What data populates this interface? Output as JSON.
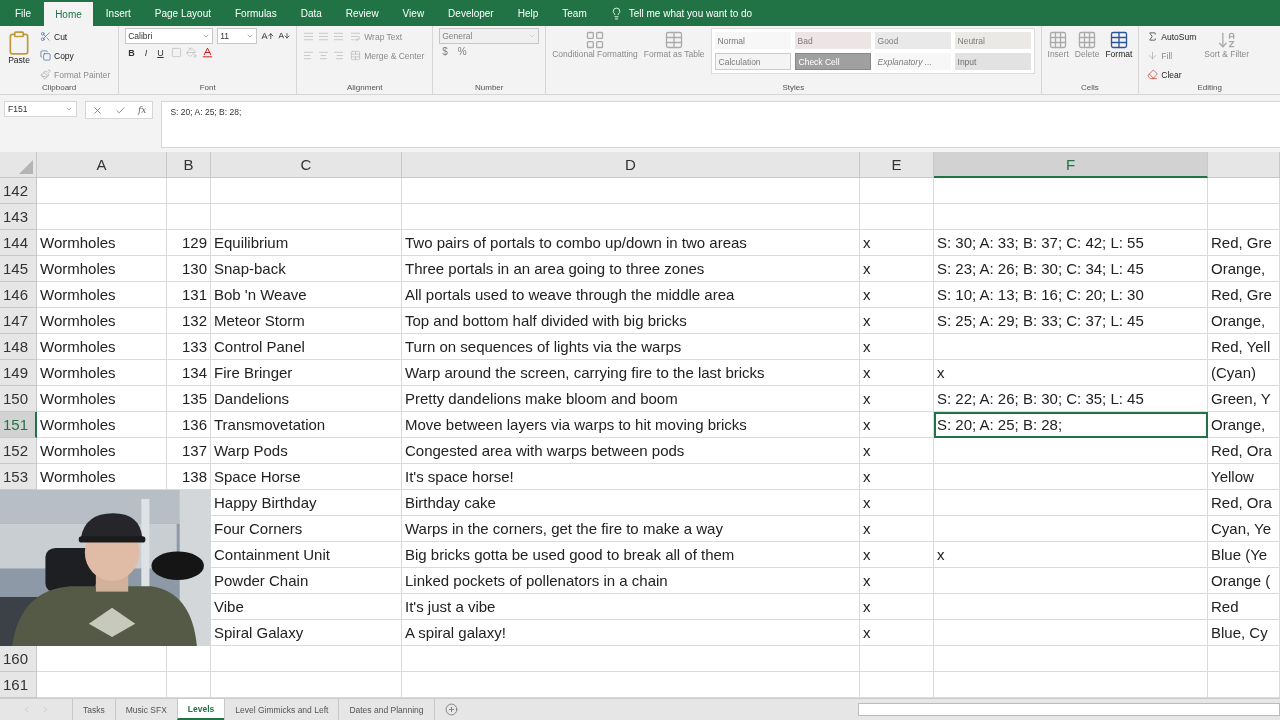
{
  "ribbon_tabs": [
    {
      "label": "File",
      "selected": false
    },
    {
      "label": "Home",
      "selected": true
    },
    {
      "label": "Insert",
      "selected": false
    },
    {
      "label": "Page Layout",
      "selected": false
    },
    {
      "label": "Formulas",
      "selected": false
    },
    {
      "label": "Data",
      "selected": false
    },
    {
      "label": "Review",
      "selected": false
    },
    {
      "label": "View",
      "selected": false
    },
    {
      "label": "Developer",
      "selected": false
    },
    {
      "label": "Help",
      "selected": false
    },
    {
      "label": "Team",
      "selected": false
    }
  ],
  "tell_me": "Tell me what you want to do",
  "ribbon": {
    "clipboard": {
      "label": "Clipboard",
      "paste": {
        "label": "Paste",
        "disabled": false
      },
      "cut": {
        "label": "Cut",
        "disabled": false
      },
      "copy": {
        "label": "Copy",
        "disabled": false
      },
      "format_painter": {
        "label": "Format Painter",
        "disabled": true
      }
    },
    "font": {
      "label": "Font",
      "name": "Calibri",
      "size": "11",
      "bold": "B",
      "italic": "I",
      "underline": "U"
    },
    "alignment": {
      "label": "Alignment",
      "wrap_text": {
        "label": "Wrap Text",
        "disabled": true
      },
      "merge": {
        "label": "Merge & Center",
        "disabled": true
      }
    },
    "number": {
      "label": "Number",
      "format": "General",
      "currency": "$",
      "percent": "%"
    },
    "styles": {
      "label": "Styles",
      "conditional": {
        "label": "Conditional Formatting",
        "disabled": true
      },
      "format_table": {
        "label": "Format as Table",
        "disabled": true
      },
      "cell_styles": [
        {
          "label": "Normal",
          "kind": "normal"
        },
        {
          "label": "Bad",
          "kind": "bad"
        },
        {
          "label": "Good",
          "kind": "good"
        },
        {
          "label": "Neutral",
          "kind": "neutral"
        },
        {
          "label": "Calculation",
          "kind": "calculation"
        },
        {
          "label": "Check Cell",
          "kind": "check"
        },
        {
          "label": "Explanatory ...",
          "kind": "explanatory"
        },
        {
          "label": "Input",
          "kind": "input"
        }
      ]
    },
    "cells": {
      "label": "Cells",
      "insert": {
        "label": "Insert",
        "disabled": true
      },
      "delete": {
        "label": "Delete",
        "disabled": true
      },
      "format": {
        "label": "Format",
        "disabled": false
      }
    },
    "editing": {
      "label": "Editing",
      "autosum": {
        "label": "AutoSum",
        "disabled": false
      },
      "fill": {
        "label": "Fill",
        "disabled": true
      },
      "clear": {
        "label": "Clear",
        "disabled": false
      },
      "sort_filter": {
        "label": "Sort & Filter",
        "disabled": true
      }
    }
  },
  "formula_bar": {
    "name_box": "F151",
    "fx": "fx",
    "formula": "S: 20; A: 25; B: 28;"
  },
  "columns": [
    {
      "label": "A",
      "selected": false
    },
    {
      "label": "B",
      "selected": false
    },
    {
      "label": "C",
      "selected": false
    },
    {
      "label": "D",
      "selected": false
    },
    {
      "label": "E",
      "selected": false
    },
    {
      "label": "F",
      "selected": true
    }
  ],
  "rows": [
    {
      "number": "142",
      "selected": false
    },
    {
      "number": "143",
      "selected": false
    },
    {
      "number": "144",
      "selected": false,
      "a": "Wormholes",
      "b": "129",
      "c": "Equilibrium",
      "d": "Two pairs of portals to combo up/down in two areas",
      "e": "x",
      "f": "S: 30; A: 33; B: 37; C: 42; L: 55",
      "g": "Red, Gre"
    },
    {
      "number": "145",
      "selected": false,
      "a": "Wormholes",
      "b": "130",
      "c": "Snap-back",
      "d": "Three portals in an area going to three zones",
      "e": "x",
      "f": "S: 23; A: 26; B: 30; C: 34; L: 45",
      "g": "Orange,"
    },
    {
      "number": "146",
      "selected": false,
      "a": "Wormholes",
      "b": "131",
      "c": "Bob 'n Weave",
      "d": "All portals used to weave through the middle area",
      "e": "x",
      "f": "S: 10; A: 13; B: 16; C: 20; L: 30",
      "g": "Red, Gre"
    },
    {
      "number": "147",
      "selected": false,
      "a": "Wormholes",
      "b": "132",
      "c": "Meteor Storm",
      "d": "Top and bottom half divided with big bricks",
      "e": "x",
      "f": "S: 25; A: 29; B: 33; C: 37; L: 45",
      "g": "Orange,"
    },
    {
      "number": "148",
      "selected": false,
      "a": "Wormholes",
      "b": "133",
      "c": "Control Panel",
      "d": "Turn on sequences of lights via the warps",
      "e": "x",
      "g": "Red, Yell"
    },
    {
      "number": "149",
      "selected": false,
      "a": "Wormholes",
      "b": "134",
      "c": "Fire Bringer",
      "d": "Warp around the screen, carrying fire to the last bricks",
      "e": "x",
      "f": "x",
      "g": "(Cyan)"
    },
    {
      "number": "150",
      "selected": false,
      "a": "Wormholes",
      "b": "135",
      "c": "Dandelions",
      "d": "Pretty dandelions make bloom and boom",
      "e": "x",
      "f": "S: 22; A: 26; B: 30; C: 35; L: 45",
      "g": "Green, Y"
    },
    {
      "number": "151",
      "selected": true,
      "a": "Wormholes",
      "b": "136",
      "c": "Transmovetation",
      "d": "Move between layers via warps to hit moving bricks",
      "e": "x",
      "f": "S: 20; A: 25; B: 28;",
      "g": "Orange,"
    },
    {
      "number": "152",
      "selected": false,
      "a": "Wormholes",
      "b": "137",
      "c": "Warp Pods",
      "d": "Congested area with warps between pods",
      "e": "x",
      "g": "Red, Ora"
    },
    {
      "number": "153",
      "selected": false,
      "a": "Wormholes",
      "b": "138",
      "c": "Space Horse",
      "d": "It's space horse!",
      "e": "x",
      "g": "Yellow"
    },
    {
      "c": "Happy Birthday",
      "d": "Birthday cake",
      "e": "x",
      "g": "Red, Ora"
    },
    {
      "c": "Four Corners",
      "d": "Warps in the corners, get the fire to make a way",
      "e": "x",
      "g": "Cyan, Ye"
    },
    {
      "c": "Containment Unit",
      "d": "Big bricks gotta be used good to break all of them",
      "e": "x",
      "f": "x",
      "g": "Blue (Ye"
    },
    {
      "c": "Powder Chain",
      "d": "Linked pockets of pollenators in a chain",
      "e": "x",
      "g": "Orange ("
    },
    {
      "c": "Vibe",
      "d": "It's just a vibe",
      "e": "x",
      "g": "Red"
    },
    {
      "c": "Spiral Galaxy",
      "d": "A spiral galaxy!",
      "e": "x",
      "g": "Blue, Cy"
    },
    {
      "number": "160",
      "selected": false
    },
    {
      "number": "161",
      "selected": false
    }
  ],
  "sheet_tabs": [
    {
      "label": "Tasks",
      "selected": false
    },
    {
      "label": "Music SFX",
      "selected": false
    },
    {
      "label": "Levels",
      "selected": true
    },
    {
      "label": "Level Gimmicks and Left",
      "selected": false
    },
    {
      "label": "Dates and Planning",
      "selected": false
    }
  ]
}
